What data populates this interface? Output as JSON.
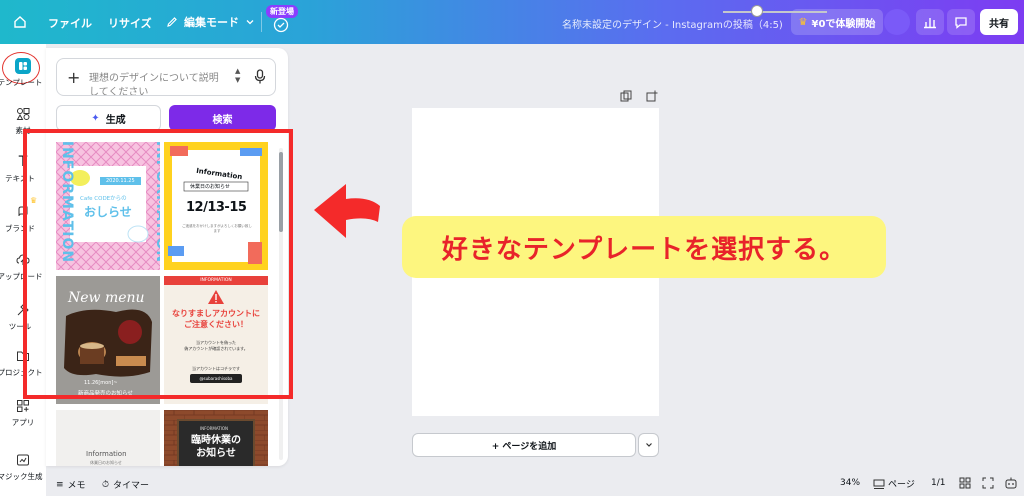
{
  "topbar": {
    "file": "ファイル",
    "resize": "リサイズ",
    "edit_mode": "編集モード",
    "new_badge": "新登場",
    "design_title": "名称未設定のデザイン - Instagramの投稿（4:5)",
    "trial": "¥0で体験開始",
    "share": "共有"
  },
  "rail": {
    "template": "テンプレート",
    "elements": "素材",
    "text": "テキスト",
    "brand": "ブランド",
    "upload": "アップロード",
    "tools": "ツール",
    "projects": "プロジェクト",
    "apps": "アプリ",
    "magic": "マジック生成"
  },
  "panel": {
    "search_placeholder": "理想のデザインについて説明してください",
    "generate": "生成",
    "search": "検索",
    "templates": [
      {
        "title": "INFORMATION",
        "date": "2020.11.25",
        "from": "Cafe CODEからの",
        "main": "おしらせ"
      },
      {
        "title": "Information",
        "sub": "休業日のお知らせ",
        "date": "12/13-15",
        "note": "ご迷惑をおかけしますがよろしくお願い致します"
      },
      {
        "title": "New menu",
        "date": "11.26[mon]~",
        "sub": "新商品発売のお知らせ"
      },
      {
        "header": "INFORMATION",
        "main": "なりすましアカウントに\nご注意ください！",
        "body": "当アカウントを偽った\n偽アカウントが確認されています。",
        "tag": "当アカウントはコチラです",
        "handle": "@subarashisoba"
      },
      {
        "title": "Information",
        "sub": "休業日のお知らせ"
      },
      {
        "title": "INFORMATION",
        "main": "臨時休業の\nお知らせ"
      }
    ]
  },
  "canvas": {
    "add_page": "+ ページを追加"
  },
  "bottombar": {
    "memo": "メモ",
    "timer": "タイマー",
    "zoom_level": 34,
    "zoom": "34%",
    "pages": "ページ",
    "page_count": "1/1"
  },
  "annotation": {
    "callout": "好きなテンプレートを選択する。"
  },
  "colors": {
    "accent": "#7d2ae8",
    "annotation_red": "#f42a2a",
    "callout_bg": "#fdf67f",
    "active_rail": "#0ba5c8"
  }
}
